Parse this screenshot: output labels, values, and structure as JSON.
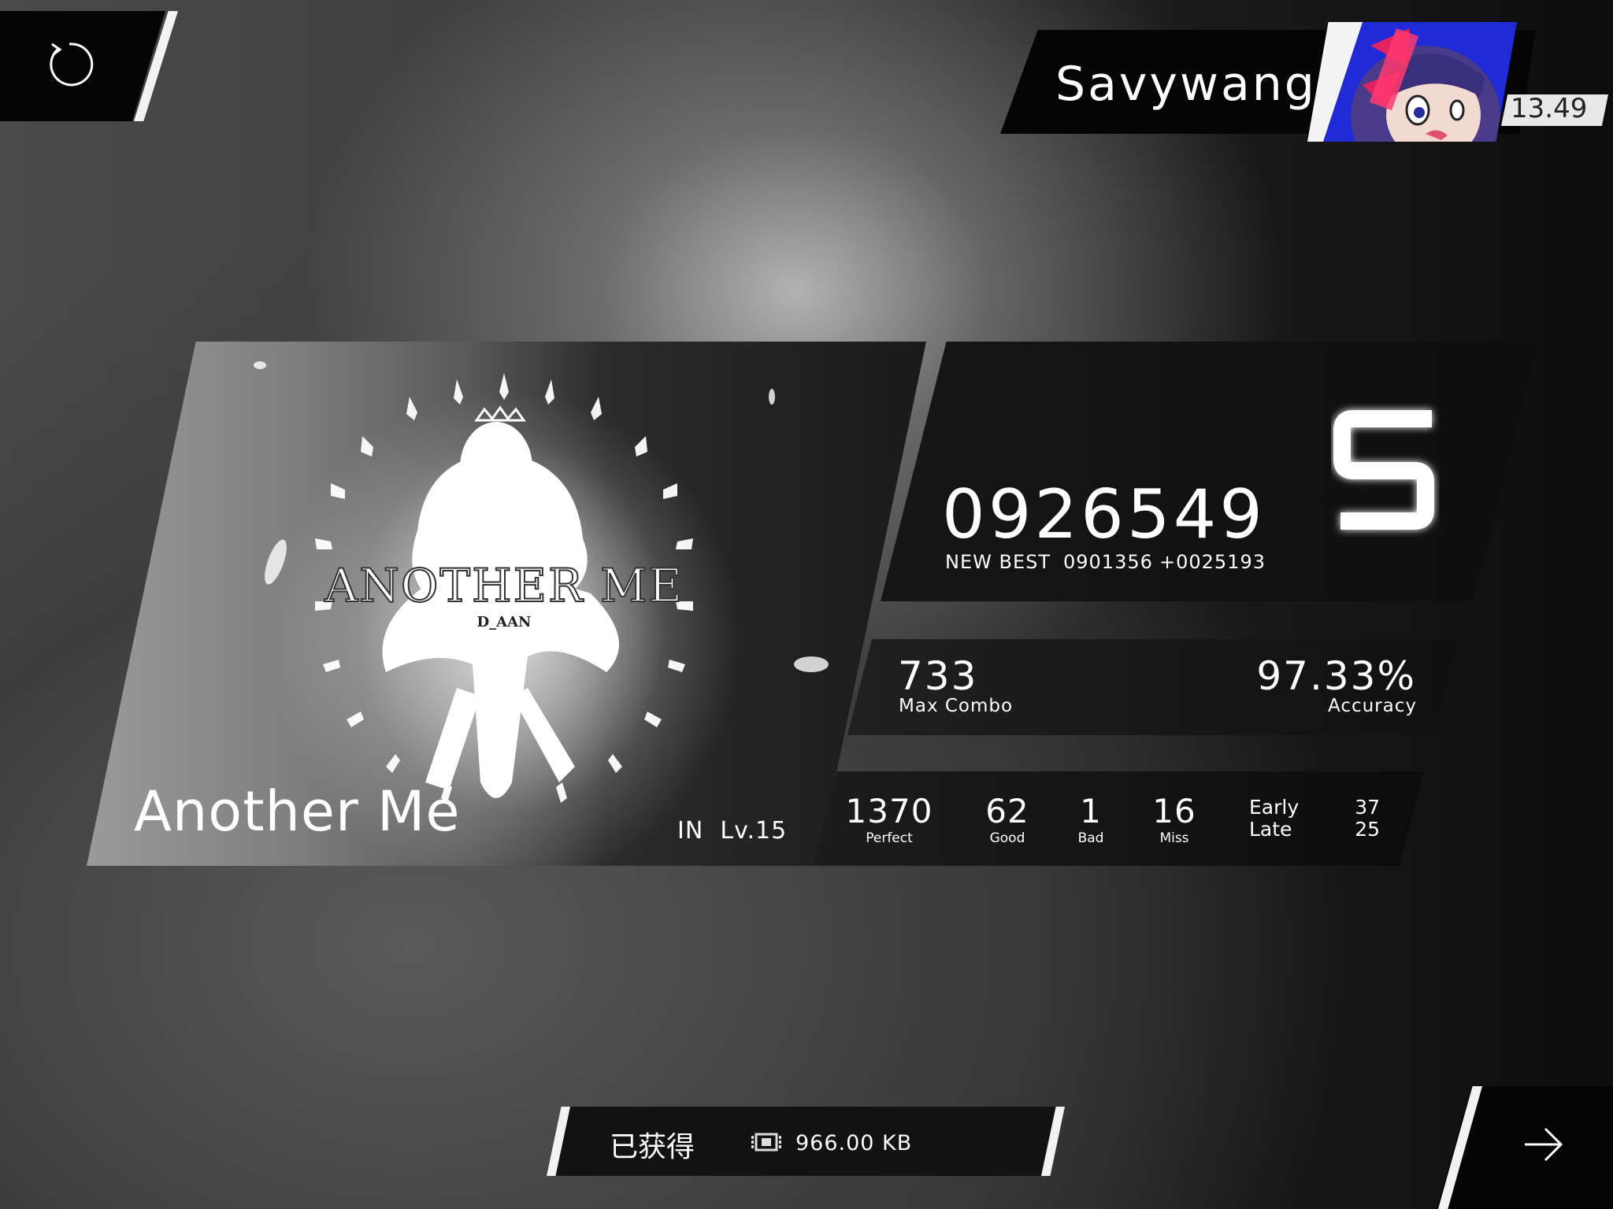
{
  "player": {
    "name": "Savywang",
    "rks": "13.49"
  },
  "song": {
    "title": "Another Me",
    "difficulty": "IN",
    "level": "Lv.15",
    "art_title": "ANOTHER ME",
    "art_artist": "D_AAN"
  },
  "result": {
    "score": "0926549",
    "grade": "S",
    "best_label": "NEW BEST",
    "previous_best": "0901356",
    "delta": "+0025193",
    "max_combo": "733",
    "max_combo_label": "Max Combo",
    "accuracy": "97.33%",
    "accuracy_label": "Accuracy",
    "judgements": [
      {
        "value": "1370",
        "label": "Perfect"
      },
      {
        "value": "62",
        "label": "Good"
      },
      {
        "value": "1",
        "label": "Bad"
      },
      {
        "value": "16",
        "label": "Miss"
      }
    ],
    "early_label": "Early",
    "late_label": "Late",
    "early": "37",
    "late": "25"
  },
  "reward": {
    "label": "已获得",
    "icon": "data-chip-icon",
    "amount": "966.00 KB"
  },
  "icons": {
    "retry": "retry-icon",
    "next": "arrow-right-icon"
  },
  "colors": {
    "panel": "#0e0e0e",
    "accent": "#f2f2f2"
  }
}
